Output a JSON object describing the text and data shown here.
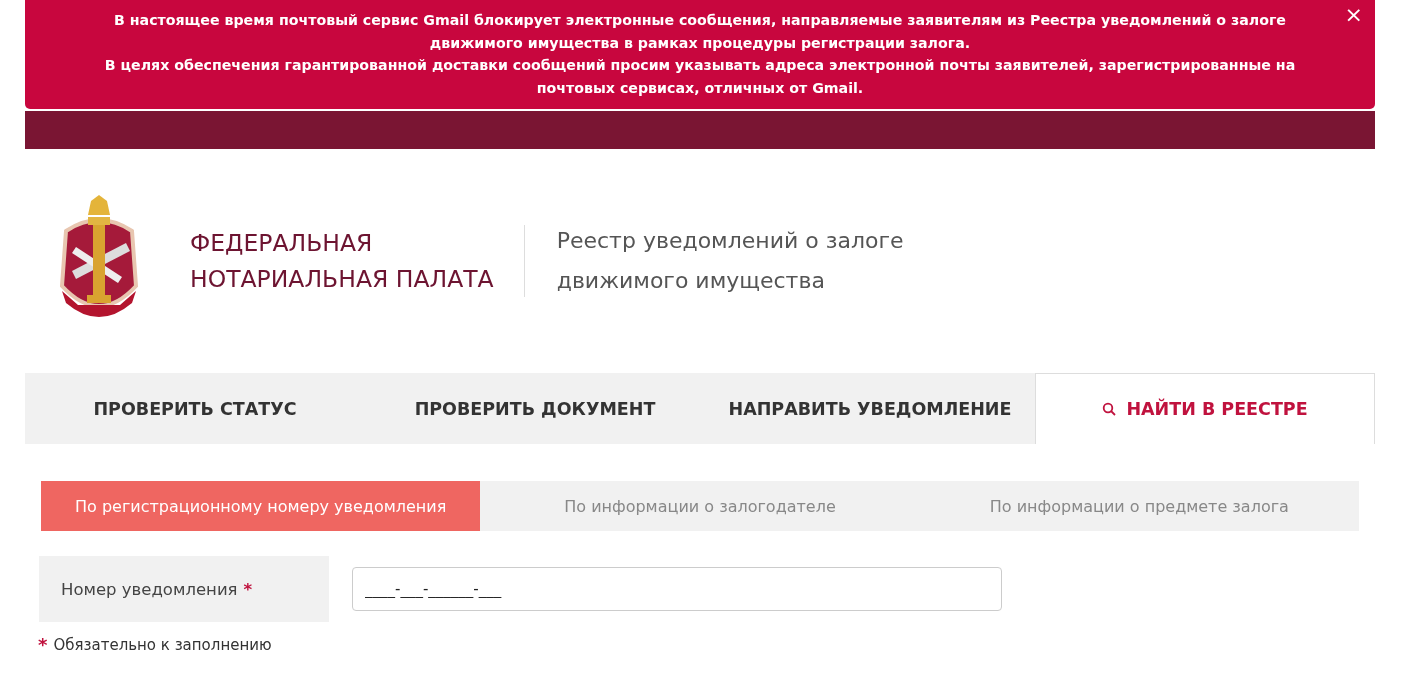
{
  "alert": {
    "paragraphs": [
      "В настоящее время почтовый сервис Gmail блокирует электронные сообщения, направляемые заявителям из Реестра уведомлений о залоге движимого имущества в рамках процедуры регистрации залога.",
      "В целях обеспечения гарантированной доставки сообщений просим указывать адреса электронной почты заявителей, зарегистрированные на почтовых сервисах, отличных от Gmail."
    ],
    "close": "×"
  },
  "header": {
    "org_name": [
      "ФЕДЕРАЛЬНАЯ",
      "НОТАРИАЛЬНАЯ ПАЛАТА"
    ],
    "registry_title": [
      "Реестр уведомлений о залоге",
      "движимого имущества"
    ]
  },
  "tabs": [
    {
      "label": "ПРОВЕРИТЬ СТАТУС",
      "selected": false,
      "kind": "plain"
    },
    {
      "label": "ПРОВЕРИТЬ ДОКУМЕНТ",
      "selected": false,
      "kind": "plain"
    },
    {
      "label": "НАПРАВИТЬ УВЕДОМЛЕНИЕ",
      "selected": false,
      "kind": "plain"
    },
    {
      "label": "НАЙТИ В РЕЕСТРЕ",
      "selected": true,
      "kind": "search"
    }
  ],
  "search_modes": [
    {
      "label": "По регистрационному номеру уведомления",
      "selected": true
    },
    {
      "label": "По информации о залогодателе",
      "selected": false
    },
    {
      "label": "По информации о предмете залога",
      "selected": false
    }
  ],
  "form": {
    "field": {
      "label": "Номер уведомления",
      "required_mark": "*",
      "value": "____-___-______-___"
    },
    "note": {
      "mark": "*",
      "text": "Обязательно к заполнению"
    }
  }
}
